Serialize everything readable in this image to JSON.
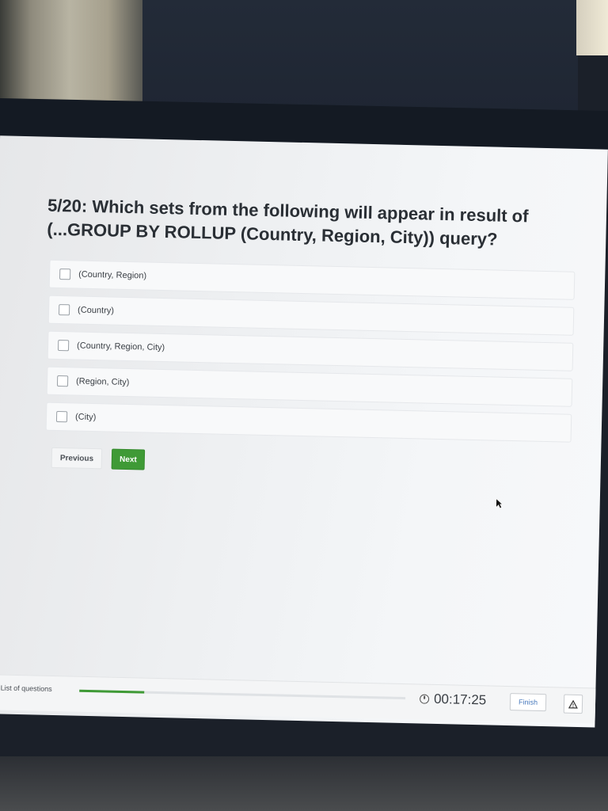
{
  "question": {
    "text": "5/20: Which sets from the following will appear in result of (...GROUP BY ROLLUP (Country, Region, City)) query?"
  },
  "options": [
    {
      "label": "(Country, Region)",
      "checked": false
    },
    {
      "label": "(Country)",
      "checked": false
    },
    {
      "label": "(Country, Region, City)",
      "checked": false
    },
    {
      "label": "(Region, City)",
      "checked": false
    },
    {
      "label": "(City)",
      "checked": false
    }
  ],
  "nav": {
    "previous_label": "Previous",
    "next_label": "Next"
  },
  "footer": {
    "list_label": "List of questions",
    "list_icon": "collapse-left-icon",
    "progress_fraction": 0.2,
    "timer": "00:17:25",
    "finish_label": "Finish",
    "warning_icon": "warning-triangle-icon"
  },
  "colors": {
    "accent_green": "#3f9a36",
    "finish_text": "#4a7bbd"
  }
}
